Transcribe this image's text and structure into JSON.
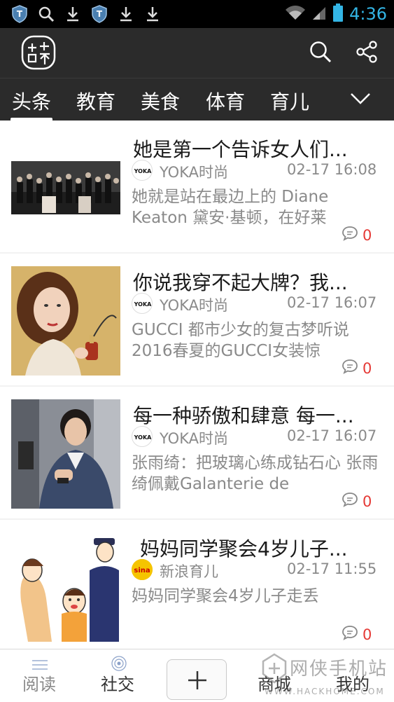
{
  "status_bar": {
    "time": "4:36",
    "icons": [
      "shield-icon",
      "search-icon",
      "download-icon",
      "shield-icon",
      "download-icon",
      "download-icon",
      "wifi-icon",
      "signal-icon",
      "battery-icon"
    ]
  },
  "header": {
    "logo_icon": "app-logo-icon",
    "search_icon": "search-icon",
    "share_icon": "share-icon"
  },
  "tabs": [
    {
      "label": "头条",
      "active": true
    },
    {
      "label": "教育",
      "active": false
    },
    {
      "label": "美食",
      "active": false
    },
    {
      "label": "体育",
      "active": false
    },
    {
      "label": "育儿",
      "active": false
    }
  ],
  "feed": [
    {
      "title": "她是第一个告诉女人们...",
      "source": "YOKA时尚",
      "source_logo_text": "YOKA",
      "time": "02-17 16:08",
      "summary": "她就是站在最边上的 Diane Keaton 黛安·基顿，在好莱",
      "comments": "0"
    },
    {
      "title": "你说我穿不起大牌？我...",
      "source": "YOKA时尚",
      "source_logo_text": "YOKA",
      "time": "02-17 16:07",
      "summary": "GUCCI 都市少女的复古梦听说2016春夏的GUCCI女装惊",
      "comments": "0"
    },
    {
      "title": "每一种骄傲和肆意 每一...",
      "source": "YOKA时尚",
      "source_logo_text": "YOKA",
      "time": "02-17 16:07",
      "summary": "张雨绮：把玻璃心练成钻石心 张雨绮佩戴Galanterie de",
      "comments": "0"
    },
    {
      "title": "妈妈同学聚会4岁儿子...",
      "source": "新浪育儿",
      "source_logo_text": "sina",
      "time": "02-17 11:55",
      "summary": "妈妈同学聚会4岁儿子走丢",
      "comments": "0"
    }
  ],
  "bottom_nav": {
    "items": [
      {
        "label": "阅读",
        "icon": "menu-lines-icon"
      },
      {
        "label": "社交",
        "icon": "target-icon"
      },
      {
        "label": "+",
        "icon": "plus-icon"
      },
      {
        "label": "商城",
        "icon": "store-icon"
      },
      {
        "label": "我的",
        "icon": "profile-icon"
      }
    ]
  },
  "watermark": {
    "text": "网侠手机站",
    "url": "WWW.HACKHOME.COM"
  },
  "colors": {
    "header_bg": "#2b2b2b",
    "comment_count": "#e53935",
    "time_accent": "#33b5e5"
  }
}
